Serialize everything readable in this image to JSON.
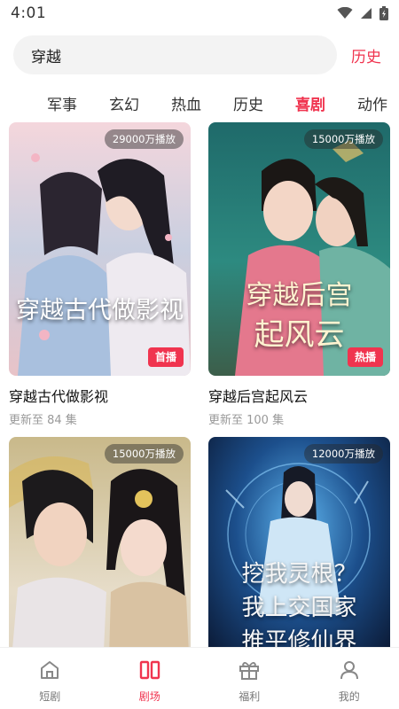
{
  "status": {
    "time": "4:01"
  },
  "search": {
    "query": "穿越",
    "history_label": "历史"
  },
  "tabs": [
    {
      "label": "军事",
      "active": false
    },
    {
      "label": "玄幻",
      "active": false
    },
    {
      "label": "热血",
      "active": false
    },
    {
      "label": "历史",
      "active": false
    },
    {
      "label": "喜剧",
      "active": true
    },
    {
      "label": "动作",
      "active": false
    }
  ],
  "cards": [
    {
      "plays": "29000万播放",
      "tag": "首播",
      "poster_text": "穿越古代做影视",
      "title": "穿越古代做影视",
      "subtitle": "更新至 84 集"
    },
    {
      "plays": "15000万播放",
      "tag": "热播",
      "poster_text_1": "穿越后宫",
      "poster_text_2": "起风云",
      "title": "穿越后宫起风云",
      "subtitle": "更新至 100 集"
    },
    {
      "plays": "15000万播放"
    },
    {
      "plays": "12000万播放",
      "poster_text_1": "挖我灵根？",
      "poster_text_2": "我上交国家",
      "poster_text_3": "推平修仙界"
    }
  ],
  "nav": [
    {
      "label": "短剧",
      "icon": "home-icon",
      "active": false
    },
    {
      "label": "剧场",
      "icon": "theater-icon",
      "active": true
    },
    {
      "label": "福利",
      "icon": "gift-icon",
      "active": false
    },
    {
      "label": "我的",
      "icon": "user-icon",
      "active": false
    }
  ],
  "colors": {
    "accent": "#f0344f"
  }
}
